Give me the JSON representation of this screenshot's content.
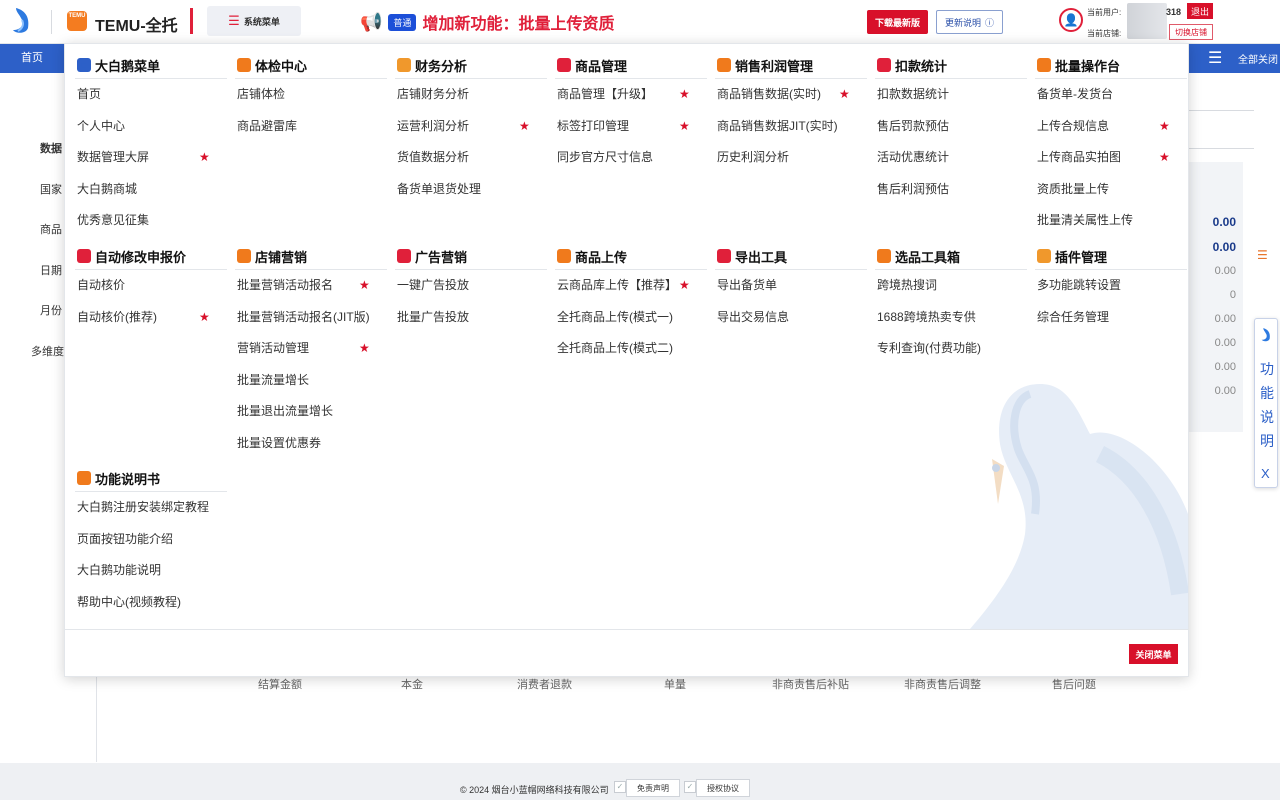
{
  "header": {
    "brand_title": "TEMU-全托",
    "system_menu_label": "系统菜单",
    "announcement_badge": "普通",
    "announcement_text": "增加新功能：批量上传资质",
    "download_label": "下载最新版",
    "update_label": "更新说明",
    "user_label": "当前用户:",
    "store_label": "当前店铺:",
    "user_id_suffix": "318",
    "logout_label": "退出",
    "switch_store_label": "切换店铺",
    "temu_logo_text": "TEMU"
  },
  "navbar": {
    "home_tab": "首页",
    "close_all_label": "全部关闭"
  },
  "background_sidebar": [
    "数据",
    "国家",
    "商品",
    "日期",
    "月份",
    "多维度"
  ],
  "background_columns": [
    "结算金额",
    "本金",
    "消费者退款",
    "单量",
    "非商责售后补贴",
    "非商责售后调整",
    "售后问题"
  ],
  "background_values": [
    "0.00",
    "0.00",
    "0.00",
    "0",
    "0.00",
    "0.00",
    "0.00",
    "0.00"
  ],
  "side_help": {
    "chars": [
      "功",
      "能",
      "说",
      "明"
    ],
    "close": "X"
  },
  "footer": {
    "copyright": "© 2024 烟台小蓝帽网络科技有限公司",
    "disclaimer_label": "免责声明",
    "license_label": "授权协议"
  },
  "menu": {
    "close_label": "关闭菜单",
    "sections": [
      {
        "title": "大白鹅菜单",
        "icon_color": "#2d60c8",
        "items": [
          {
            "label": "首页",
            "star": false
          },
          {
            "label": "个人中心",
            "star": false
          },
          {
            "label": "数据管理大屏",
            "star": true
          },
          {
            "label": "大白鹅商城",
            "star": false
          },
          {
            "label": "优秀意见征集",
            "star": false
          }
        ]
      },
      {
        "title": "体检中心",
        "icon_color": "#f07a1c",
        "items": [
          {
            "label": "店铺体检",
            "star": false
          },
          {
            "label": "商品避雷库",
            "star": false
          }
        ]
      },
      {
        "title": "财务分析",
        "icon_color": "#f0982c",
        "items": [
          {
            "label": "店铺财务分析",
            "star": false
          },
          {
            "label": "运营利润分析",
            "star": true
          },
          {
            "label": "货值数据分析",
            "star": false
          },
          {
            "label": "备货单退货处理",
            "star": false
          }
        ]
      },
      {
        "title": "商品管理",
        "icon_color": "#e0203a",
        "items": [
          {
            "label": "商品管理【升级】",
            "star": true
          },
          {
            "label": "标签打印管理",
            "star": true
          },
          {
            "label": "同步官方尺寸信息",
            "star": false
          }
        ]
      },
      {
        "title": "销售利润管理",
        "icon_color": "#f07a1c",
        "items": [
          {
            "label": "商品销售数据(实时)",
            "star": true
          },
          {
            "label": "商品销售数据JIT(实时)",
            "star": false
          },
          {
            "label": "历史利润分析",
            "star": false
          }
        ]
      },
      {
        "title": "扣款统计",
        "icon_color": "#e0203a",
        "items": [
          {
            "label": "扣款数据统计",
            "star": false
          },
          {
            "label": "售后罚款预估",
            "star": false
          },
          {
            "label": "活动优惠统计",
            "star": false
          },
          {
            "label": "售后利润预估",
            "star": false
          }
        ]
      },
      {
        "title": "批量操作台",
        "icon_color": "#f07a1c",
        "items": [
          {
            "label": "备货单-发货台",
            "star": false
          },
          {
            "label": "上传合规信息",
            "star": true
          },
          {
            "label": "上传商品实拍图",
            "star": true
          },
          {
            "label": "资质批量上传",
            "star": false
          },
          {
            "label": "批量清关属性上传",
            "star": false
          }
        ]
      },
      {
        "title": "自动修改申报价",
        "icon_color": "#e0203a",
        "items": [
          {
            "label": "自动核价",
            "star": false
          },
          {
            "label": "自动核价(推荐)",
            "star": true
          }
        ]
      },
      {
        "title": "店铺营销",
        "icon_color": "#f07a1c",
        "items": [
          {
            "label": "批量营销活动报名",
            "star": true
          },
          {
            "label": "批量营销活动报名(JIT版)",
            "star": false
          },
          {
            "label": "营销活动管理",
            "star": true
          },
          {
            "label": "批量流量增长",
            "star": false
          },
          {
            "label": "批量退出流量增长",
            "star": false
          },
          {
            "label": "批量设置优惠券",
            "star": false
          }
        ]
      },
      {
        "title": "广告营销",
        "icon_color": "#e0203a",
        "items": [
          {
            "label": "一键广告投放",
            "star": false
          },
          {
            "label": "批量广告投放",
            "star": false
          }
        ]
      },
      {
        "title": "商品上传",
        "icon_color": "#f07a1c",
        "items": [
          {
            "label": "云商品库上传【推荐】",
            "star": true
          },
          {
            "label": "全托商品上传(模式一)",
            "star": false
          },
          {
            "label": "全托商品上传(模式二)",
            "star": false
          }
        ]
      },
      {
        "title": "导出工具",
        "icon_color": "#e0203a",
        "items": [
          {
            "label": "导出备货单",
            "star": false
          },
          {
            "label": "导出交易信息",
            "star": false
          }
        ]
      },
      {
        "title": "选品工具箱",
        "icon_color": "#f07a1c",
        "items": [
          {
            "label": "跨境热搜词",
            "star": false
          },
          {
            "label": "1688跨境热卖专供",
            "star": false
          },
          {
            "label": "专利查询(付费功能)",
            "star": false
          }
        ]
      },
      {
        "title": "插件管理",
        "icon_color": "#f0982c",
        "items": [
          {
            "label": "多功能跳转设置",
            "star": false
          },
          {
            "label": "综合任务管理",
            "star": false
          }
        ]
      },
      {
        "title": "功能说明书",
        "icon_color": "#f07a1c",
        "items": [
          {
            "label": "大白鹅注册安装绑定教程",
            "star": false
          },
          {
            "label": "页面按钮功能介绍",
            "star": false
          },
          {
            "label": "大白鹅功能说明",
            "star": false
          },
          {
            "label": "帮助中心(视频教程)",
            "star": false
          }
        ]
      }
    ]
  }
}
